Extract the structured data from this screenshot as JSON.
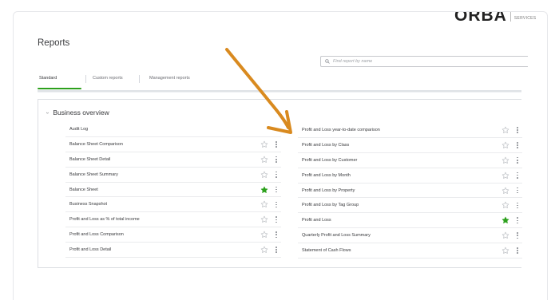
{
  "brand": {
    "logo_text": "ORBA",
    "logo_sub_line1": "",
    "logo_sub_line2": "SERVICES"
  },
  "page": {
    "title": "Reports"
  },
  "search": {
    "placeholder": "Find report by name",
    "icon": "search-icon"
  },
  "tabs": [
    {
      "label": "Standard",
      "active": true
    },
    {
      "label": "Custom reports",
      "active": false
    },
    {
      "label": "Management reports",
      "active": false
    }
  ],
  "section": {
    "title": "Business overview",
    "expanded": true
  },
  "left_reports": [
    {
      "label": "Audit Log",
      "favorite": false,
      "show_actions": false
    },
    {
      "label": "Balance Sheet Comparison",
      "favorite": false,
      "show_actions": true
    },
    {
      "label": "Balance Sheet Detail",
      "favorite": false,
      "show_actions": true
    },
    {
      "label": "Balance Sheet Summary",
      "favorite": false,
      "show_actions": true
    },
    {
      "label": "Balance Sheet",
      "favorite": true,
      "show_actions": true
    },
    {
      "label": "Business Snapshot",
      "favorite": false,
      "show_actions": true
    },
    {
      "label": "Profit and Loss as % of total income",
      "favorite": false,
      "show_actions": true
    },
    {
      "label": "Profit and Loss Comparison",
      "favorite": false,
      "show_actions": true
    },
    {
      "label": "Profit and Loss Detail",
      "favorite": false,
      "show_actions": true
    }
  ],
  "right_reports": [
    {
      "label": "Profit and Loss year-to-date comparison",
      "favorite": false,
      "show_actions": true
    },
    {
      "label": "Profit and Loss by Class",
      "favorite": false,
      "show_actions": true
    },
    {
      "label": "Profit and Loss by Customer",
      "favorite": false,
      "show_actions": true
    },
    {
      "label": "Profit and Loss by Month",
      "favorite": false,
      "show_actions": true
    },
    {
      "label": "Profit and Loss by Property",
      "favorite": false,
      "show_actions": true
    },
    {
      "label": "Profit and Loss by Tag Group",
      "favorite": false,
      "show_actions": true
    },
    {
      "label": "Profit and Loss",
      "favorite": true,
      "show_actions": true
    },
    {
      "label": "Quarterly Profit and Loss Summary",
      "favorite": false,
      "show_actions": true
    },
    {
      "label": "Statement of Cash Flows",
      "favorite": false,
      "show_actions": true
    }
  ],
  "colors": {
    "accent_green": "#2ca01c",
    "annotation_arrow": "#d98a1f",
    "star_outline": "#b9bcc1",
    "text": "#393a3d"
  }
}
